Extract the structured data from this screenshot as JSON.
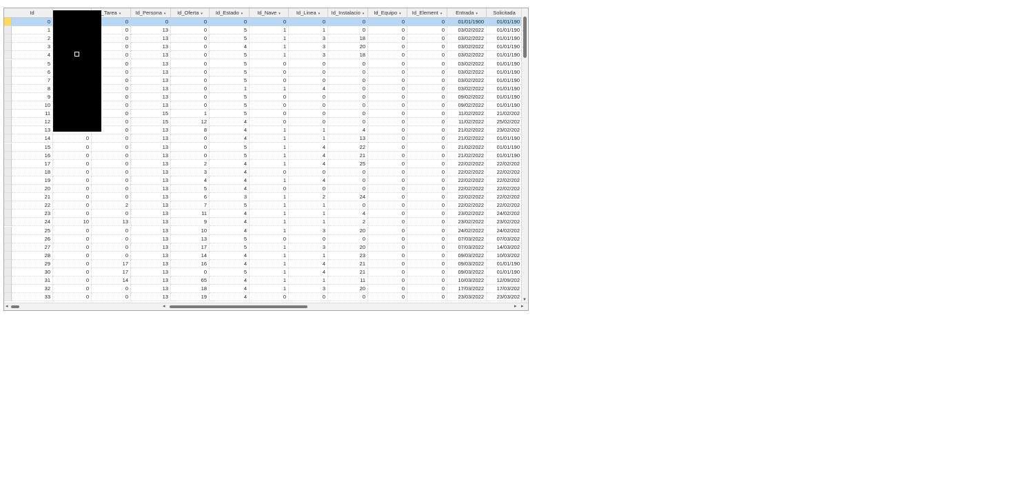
{
  "table": {
    "columns": [
      {
        "name": "id",
        "label": "Id",
        "type": "num"
      },
      {
        "name": "redacted",
        "label": "",
        "type": "num"
      },
      {
        "name": "tarea",
        "label": "_Tarea",
        "type": "num"
      },
      {
        "name": "persona",
        "label": "Id_Persona",
        "type": "num"
      },
      {
        "name": "oferta",
        "label": "Id_Oferta",
        "type": "num"
      },
      {
        "name": "estado",
        "label": "Id_Estado",
        "type": "num"
      },
      {
        "name": "nave",
        "label": "Id_Nave",
        "type": "num"
      },
      {
        "name": "linea",
        "label": "Id_Linea",
        "type": "num"
      },
      {
        "name": "instalacion",
        "label": "Id_Instalacio",
        "type": "num"
      },
      {
        "name": "equipo",
        "label": "Id_Equipo",
        "type": "num"
      },
      {
        "name": "elemento",
        "label": "Id_Element",
        "type": "num"
      },
      {
        "name": "entrada",
        "label": "Entrada",
        "type": "date"
      },
      {
        "name": "solicitada",
        "label": "Solicitada",
        "type": "date"
      }
    ],
    "rows": [
      [
        "0",
        "",
        "0",
        "0",
        "0",
        "0",
        "0",
        "0",
        "0",
        "0",
        "0",
        "01/01/1900",
        "01/01/190"
      ],
      [
        "1",
        "",
        "0",
        "13",
        "0",
        "5",
        "1",
        "1",
        "0",
        "0",
        "0",
        "03/02/2022",
        "01/01/190"
      ],
      [
        "2",
        "",
        "0",
        "13",
        "0",
        "5",
        "1",
        "3",
        "18",
        "0",
        "0",
        "03/02/2022",
        "01/01/190"
      ],
      [
        "3",
        "",
        "0",
        "13",
        "0",
        "4",
        "1",
        "3",
        "20",
        "0",
        "0",
        "03/02/2022",
        "01/01/190"
      ],
      [
        "4",
        "",
        "0",
        "13",
        "0",
        "5",
        "1",
        "3",
        "18",
        "0",
        "0",
        "03/02/2022",
        "01/01/190"
      ],
      [
        "5",
        "",
        "0",
        "13",
        "0",
        "5",
        "0",
        "0",
        "0",
        "0",
        "0",
        "03/02/2022",
        "01/01/190"
      ],
      [
        "6",
        "",
        "0",
        "13",
        "0",
        "5",
        "0",
        "0",
        "0",
        "0",
        "0",
        "03/02/2022",
        "01/01/190"
      ],
      [
        "7",
        "",
        "0",
        "13",
        "0",
        "5",
        "0",
        "0",
        "0",
        "0",
        "0",
        "03/02/2022",
        "01/01/190"
      ],
      [
        "8",
        "",
        "0",
        "13",
        "0",
        "1",
        "1",
        "4",
        "0",
        "0",
        "0",
        "03/02/2022",
        "01/01/190"
      ],
      [
        "9",
        "",
        "0",
        "13",
        "0",
        "5",
        "0",
        "0",
        "0",
        "0",
        "0",
        "09/02/2022",
        "01/01/190"
      ],
      [
        "10",
        "",
        "0",
        "13",
        "0",
        "5",
        "0",
        "0",
        "0",
        "0",
        "0",
        "09/02/2022",
        "01/01/190"
      ],
      [
        "11",
        "",
        "0",
        "15",
        "1",
        "5",
        "0",
        "0",
        "0",
        "0",
        "0",
        "11/02/2022",
        "21/02/202"
      ],
      [
        "12",
        "",
        "0",
        "15",
        "12",
        "4",
        "0",
        "0",
        "0",
        "0",
        "0",
        "11/02/2022",
        "25/02/202"
      ],
      [
        "13",
        "",
        "0",
        "13",
        "8",
        "4",
        "1",
        "1",
        "4",
        "0",
        "0",
        "21/02/2022",
        "23/02/202"
      ],
      [
        "14",
        "0",
        "0",
        "13",
        "0",
        "4",
        "1",
        "1",
        "13",
        "0",
        "0",
        "21/02/2022",
        "01/01/190"
      ],
      [
        "15",
        "0",
        "0",
        "13",
        "0",
        "5",
        "1",
        "4",
        "22",
        "0",
        "0",
        "21/02/2022",
        "01/01/190"
      ],
      [
        "16",
        "0",
        "0",
        "13",
        "0",
        "5",
        "1",
        "4",
        "21",
        "0",
        "0",
        "21/02/2022",
        "01/01/190"
      ],
      [
        "17",
        "0",
        "0",
        "13",
        "2",
        "4",
        "1",
        "4",
        "25",
        "0",
        "0",
        "22/02/2022",
        "22/02/202"
      ],
      [
        "18",
        "0",
        "0",
        "13",
        "3",
        "4",
        "0",
        "0",
        "0",
        "0",
        "0",
        "22/02/2022",
        "22/02/202"
      ],
      [
        "19",
        "0",
        "0",
        "13",
        "4",
        "4",
        "1",
        "4",
        "0",
        "0",
        "0",
        "22/02/2022",
        "22/02/202"
      ],
      [
        "20",
        "0",
        "0",
        "13",
        "5",
        "4",
        "0",
        "0",
        "0",
        "0",
        "0",
        "22/02/2022",
        "22/02/202"
      ],
      [
        "21",
        "0",
        "0",
        "13",
        "6",
        "3",
        "1",
        "2",
        "24",
        "0",
        "0",
        "22/02/2022",
        "22/02/202"
      ],
      [
        "22",
        "0",
        "2",
        "13",
        "7",
        "5",
        "1",
        "1",
        "0",
        "0",
        "0",
        "22/02/2022",
        "22/02/202"
      ],
      [
        "23",
        "0",
        "0",
        "13",
        "11",
        "4",
        "1",
        "1",
        "4",
        "0",
        "0",
        "23/02/2022",
        "24/02/202"
      ],
      [
        "24",
        "10",
        "13",
        "13",
        "9",
        "4",
        "1",
        "1",
        "2",
        "0",
        "0",
        "23/02/2022",
        "23/02/202"
      ],
      [
        "25",
        "0",
        "0",
        "13",
        "10",
        "4",
        "1",
        "3",
        "20",
        "0",
        "0",
        "24/02/2022",
        "24/02/202"
      ],
      [
        "26",
        "0",
        "0",
        "13",
        "13",
        "5",
        "0",
        "0",
        "0",
        "0",
        "0",
        "07/03/2022",
        "07/03/202"
      ],
      [
        "27",
        "0",
        "0",
        "13",
        "17",
        "5",
        "1",
        "3",
        "20",
        "0",
        "0",
        "07/03/2022",
        "14/03/202"
      ],
      [
        "28",
        "0",
        "0",
        "13",
        "14",
        "4",
        "1",
        "1",
        "23",
        "0",
        "0",
        "09/03/2022",
        "10/03/202"
      ],
      [
        "29",
        "0",
        "17",
        "13",
        "16",
        "4",
        "1",
        "4",
        "21",
        "0",
        "0",
        "09/03/2022",
        "01/01/190"
      ],
      [
        "30",
        "0",
        "17",
        "13",
        "0",
        "5",
        "1",
        "4",
        "21",
        "0",
        "0",
        "09/03/2022",
        "01/01/190"
      ],
      [
        "31",
        "0",
        "14",
        "13",
        "65",
        "4",
        "1",
        "1",
        "11",
        "0",
        "0",
        "10/03/2022",
        "12/09/202"
      ],
      [
        "32",
        "0",
        "0",
        "13",
        "18",
        "4",
        "1",
        "3",
        "20",
        "0",
        "0",
        "17/03/2022",
        "17/03/202"
      ],
      [
        "33",
        "0",
        "0",
        "13",
        "19",
        "4",
        "0",
        "0",
        "0",
        "0",
        "0",
        "23/03/2022",
        "23/03/202"
      ]
    ]
  },
  "colors": {
    "selected_row": "#b7d7f5",
    "row_selector_active": "#ffd95c",
    "header_bg": "#f0f0f0"
  },
  "icons": {
    "dropdown": "dropdown-arrow-icon",
    "scroll_left": "scroll-left-arrow-icon",
    "scroll_right": "scroll-right-arrow-icon",
    "scroll_down": "scroll-down-arrow-icon"
  }
}
